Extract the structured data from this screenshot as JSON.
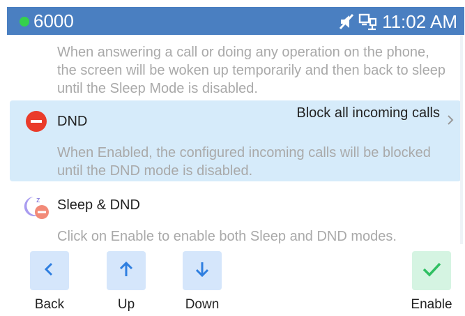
{
  "status_bar": {
    "extension": "6000",
    "time": "11:02 AM",
    "icons": [
      "mic-muted-icon",
      "network-icon"
    ],
    "dot_color": "#35d14c",
    "bar_color": "#4a7fc1"
  },
  "list": {
    "sleep_description": "When answering a call or doing any operation on the phone, the screen will be woken up temporarily and then back to sleep until the Sleep Mode is disabled.",
    "dnd": {
      "title": "DND",
      "value": "Block all incoming calls",
      "description": "When Enabled, the configured incoming calls will be blocked until the DND mode is disabled.",
      "icon": "dnd-icon"
    },
    "sleep_dnd": {
      "title": "Sleep & DND",
      "description": "Click on Enable to enable both Sleep and DND modes.",
      "icon": "sleep-dnd-icon"
    }
  },
  "softkeys": {
    "back": "Back",
    "up": "Up",
    "down": "Down",
    "enable": "Enable"
  }
}
